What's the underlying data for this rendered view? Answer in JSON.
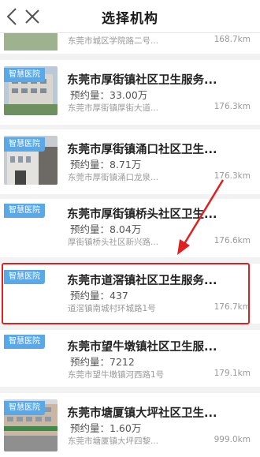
{
  "header": {
    "title": "选择机构"
  },
  "icons": {
    "back": "chevron-left-icon",
    "close": "close-icon"
  },
  "colors": {
    "badge": "#5aa9e6",
    "highlight": "#e02020"
  },
  "list": [
    {
      "name": "",
      "volume": "",
      "address": "东莞市城区学院路二号...",
      "distance": "168.7km",
      "badge": ""
    },
    {
      "name": "东莞市厚街镇社区卫生服务...",
      "volume": "预约量：33.00万",
      "address": "东莞市厚街镇厚街大道...",
      "distance": "176.3km",
      "badge": "智慧医院"
    },
    {
      "name": "东莞市厚街镇涌口社区卫生...",
      "volume": "预约量：8.71万",
      "address": "东莞市厚街镇涌口龙泉...",
      "distance": "176.3km",
      "badge": "智慧医院"
    },
    {
      "name": "东莞市厚街镇桥头社区卫生...",
      "volume": "预约量：8.04万",
      "address": "厚街镇桥头社区新兴路...",
      "distance": "176.6km",
      "badge": "智慧医院"
    },
    {
      "name": "东莞市道滘镇社区卫生服务...",
      "volume": "预约量：437",
      "address": "道滘镇南城村环城路1号",
      "distance": "176.7km",
      "badge": "智慧医院"
    },
    {
      "name": "东莞市望牛墩镇社区卫生服...",
      "volume": "预约量：7212",
      "address": "东莞市望牛墩镇河西路1号",
      "distance": "179.1km",
      "badge": "智慧医院"
    },
    {
      "name": "东莞市塘厦镇大坪社区卫生...",
      "volume": "预约量：1.60万",
      "address": "东莞市塘厦镇大坪四黎...",
      "distance": "999.0km",
      "badge": "智慧医院"
    }
  ]
}
